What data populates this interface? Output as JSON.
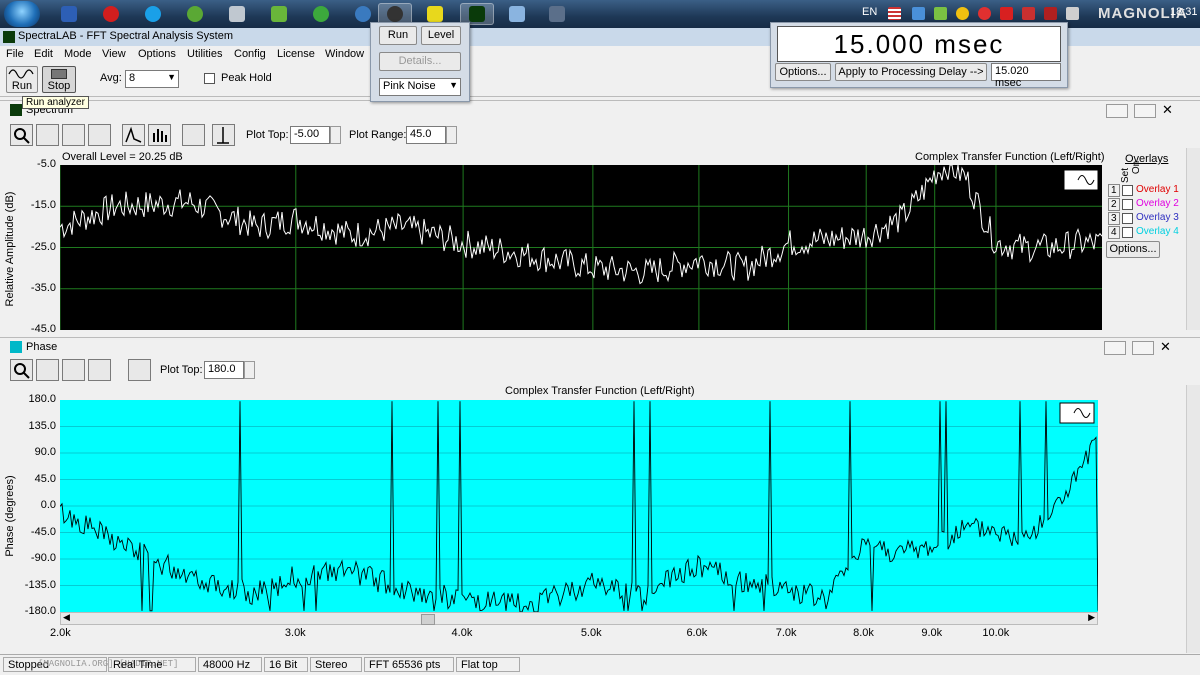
{
  "taskbar": {
    "lang": "EN",
    "clock": "18:31",
    "watermark": "MAGNOLIA",
    "watermark_sub": "[MAGNOLIA.ORG] [NADIR.NET]"
  },
  "window": {
    "title": "SpectraLAB - FFT Spectral Analysis System",
    "menu": [
      "File",
      "Edit",
      "Mode",
      "View",
      "Options",
      "Utilities",
      "Config",
      "License",
      "Window"
    ]
  },
  "toolbar": {
    "run_label": "Run",
    "stop_label": "Stop",
    "avg_label": "Avg:",
    "avg_value": "8",
    "peak_hold_label": "Peak Hold",
    "tooltip": "Run analyzer"
  },
  "generator": {
    "run_label": "Run",
    "level_label": "Level",
    "details_label": "Details...",
    "noise_value": "Pink Noise"
  },
  "delay": {
    "readout": "15.000 msec",
    "options_label": "Options...",
    "apply_label": "Apply to Processing Delay -->",
    "apply_value": "15.020 msec"
  },
  "spectrum": {
    "panel_title": "Spectrum",
    "plot_top_label": "Plot Top:",
    "plot_top_value": "-5.00",
    "plot_range_label": "Plot Range:",
    "plot_range_value": "45.0",
    "overall_level": "Overall Level = 20.25 dB",
    "chart_title": "Complex Transfer Function (Left/Right)",
    "ylabel": "Relative Amplitude (dB)",
    "ytick_labels": [
      "-5.0",
      "-15.0",
      "-25.0",
      "-35.0",
      "-45.0"
    ],
    "overlays_title": "Overlays",
    "set_label": "Set",
    "on_label": "On",
    "overlays": [
      {
        "set": "1",
        "name": "Overlay 1",
        "color": "#e00000"
      },
      {
        "set": "2",
        "name": "Overlay 2",
        "color": "#e000e0"
      },
      {
        "set": "3",
        "name": "Overlay 3",
        "color": "#3030c0"
      },
      {
        "set": "4",
        "name": "Overlay 4",
        "color": "#00d0e0"
      }
    ],
    "options_label": "Options..."
  },
  "phase": {
    "panel_title": "Phase",
    "plot_top_label": "Plot Top:",
    "plot_top_value": "180.0",
    "chart_title": "Complex Transfer Function (Left/Right)",
    "ylabel": "Phase (degrees)",
    "ytick_labels": [
      "180.0",
      "135.0",
      "90.0",
      "45.0",
      "0.0",
      "-45.0",
      "-90.0",
      "-135.0",
      "-180.0"
    ],
    "xtick_labels": [
      {
        "label": "2.0k",
        "freq": 2000
      },
      {
        "label": "3.0k",
        "freq": 3000
      },
      {
        "label": "4.0k",
        "freq": 4000
      },
      {
        "label": "5.0k",
        "freq": 5000
      },
      {
        "label": "6.0k",
        "freq": 6000
      },
      {
        "label": "7.0k",
        "freq": 7000
      },
      {
        "label": "8.0k",
        "freq": 8000
      },
      {
        "label": "9.0k",
        "freq": 9000
      },
      {
        "label": "10.0k",
        "freq": 10000
      }
    ]
  },
  "status": {
    "state": "Stopped",
    "mode": "Real Time",
    "sample_rate": "48000 Hz",
    "bits": "16 Bit",
    "channels": "Stereo",
    "fft": "FFT 65536 pts",
    "window": "Flat top"
  },
  "colors": {
    "spectrum_bg": "#000000",
    "spectrum_trace": "#ffffff",
    "grid": "#1f7a1f",
    "phase_bg": "#00ffff",
    "phase_trace": "#000000",
    "phase_grid": "#0a9aa8"
  },
  "chart_data": [
    {
      "type": "line",
      "title": "Complex Transfer Function (Left/Right)",
      "ylabel": "Relative Amplitude (dB)",
      "ylim": [
        -45,
        -5
      ],
      "xlim": [
        2000,
        12000
      ],
      "x_scale": "log",
      "grid": true,
      "series": [
        {
          "x": [
            2000,
            2200,
            2500,
            2800,
            3000,
            3300,
            3600,
            4000,
            4500,
            5000,
            5500,
            6000,
            6500,
            7000,
            7500,
            8000,
            8500,
            8800,
            9000,
            9200,
            9500,
            9800,
            10000,
            10500,
            11000,
            11500,
            12000
          ],
          "y": [
            -20,
            -15,
            -14,
            -20,
            -18,
            -22,
            -20,
            -24,
            -27,
            -30,
            -31,
            -28,
            -30,
            -24,
            -23,
            -22,
            -18,
            -12,
            -7,
            -5,
            -8,
            -18,
            -24,
            -25,
            -25,
            -24,
            -24
          ]
        }
      ]
    },
    {
      "type": "line",
      "title": "Complex Transfer Function (Left/Right)",
      "ylabel": "Phase (degrees)",
      "ylim": [
        -180,
        180
      ],
      "xlim": [
        2000,
        12000
      ],
      "x_scale": "log",
      "grid": true,
      "series": [
        {
          "x": [
            2000,
            2200,
            2400,
            2600,
            2800,
            3000,
            3300,
            3600,
            4000,
            4500,
            5000,
            5500,
            6000,
            6500,
            7000,
            7500,
            8000,
            8500,
            9000,
            9500,
            10000,
            10500,
            11000,
            11500,
            12000
          ],
          "y": [
            -10,
            -60,
            -100,
            -130,
            -150,
            -120,
            -110,
            -140,
            -160,
            -170,
            -130,
            -150,
            -100,
            -130,
            -140,
            -160,
            -60,
            -80,
            -70,
            -40,
            -40,
            -60,
            -20,
            40,
            110
          ]
        }
      ]
    }
  ]
}
